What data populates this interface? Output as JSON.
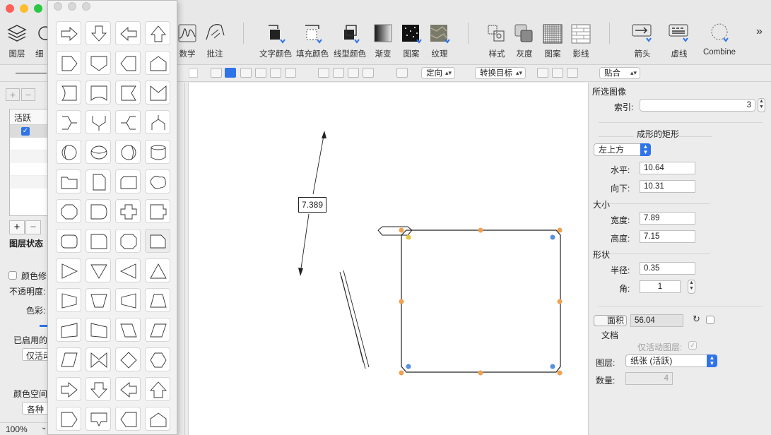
{
  "toolbar": {
    "left_items": [
      {
        "label": "图层",
        "icon": "layers-icon"
      },
      {
        "label": "细",
        "icon": "detail-icon"
      }
    ],
    "items": [
      {
        "label": "数学",
        "icon": "math-icon"
      },
      {
        "label": "批注",
        "icon": "annotation-icon"
      },
      {
        "label": "文字颜色",
        "icon": "text-color-icon"
      },
      {
        "label": "填充颜色",
        "icon": "fill-color-icon"
      },
      {
        "label": "线型颜色",
        "icon": "line-color-icon"
      },
      {
        "label": "渐变",
        "icon": "gradient-icon"
      },
      {
        "label": "图案",
        "icon": "pattern-icon"
      },
      {
        "label": "纹理",
        "icon": "texture-icon"
      },
      {
        "label": "样式",
        "icon": "style-icon"
      },
      {
        "label": "灰度",
        "icon": "grayscale-icon"
      },
      {
        "label": "图案",
        "icon": "grid-pattern-icon"
      },
      {
        "label": "影线",
        "icon": "hatch-icon"
      },
      {
        "label": "箭头",
        "icon": "arrow-icon"
      },
      {
        "label": "虚线",
        "icon": "dash-icon"
      },
      {
        "label": "Combine",
        "icon": "combine-icon"
      }
    ],
    "overflow": "»"
  },
  "subbar": {
    "direction": "定向",
    "convert_target": "转换目标",
    "snap": "贴合"
  },
  "left_panel": {
    "table_header_active": "活跃",
    "layer_state": "图层状态",
    "color_modify": "颜色修改",
    "opacity": "不透明度:",
    "hue": "色彩:",
    "enabled": "已启用的",
    "only_active": "仅活动",
    "color_space": "颜色空间",
    "various": "各种",
    "zoom": "100%"
  },
  "canvas": {
    "dimension_label": "7.389"
  },
  "inspector": {
    "selected_image": "所选图像",
    "index_label": "索引:",
    "index_value": "3",
    "shape_title": "成形的矩形",
    "anchor": "左上方",
    "horizontal_label": "水平:",
    "horizontal_value": "10.64",
    "down_label": "向下:",
    "down_value": "10.31",
    "size_title": "大小",
    "width_label": "宽度:",
    "width_value": "7.89",
    "height_label": "高度:",
    "height_value": "7.15",
    "shape_section": "形状",
    "radius_label": "半径:",
    "radius_value": "0.35",
    "corner_label": "角:",
    "corner_value": "1",
    "area_button": "面积",
    "area_value": "56.04",
    "document_title": "文档",
    "only_active_layer": "仅活动图层:",
    "layer_label": "图层:",
    "layer_value": "纸张 (活跃)",
    "count_label": "数量:",
    "count_value": "4"
  },
  "colors": {
    "accent": "#2f73e8",
    "handle_orange": "#f0a050",
    "handle_blue": "#5a8fe0",
    "handle_yellow": "#e8c640"
  }
}
